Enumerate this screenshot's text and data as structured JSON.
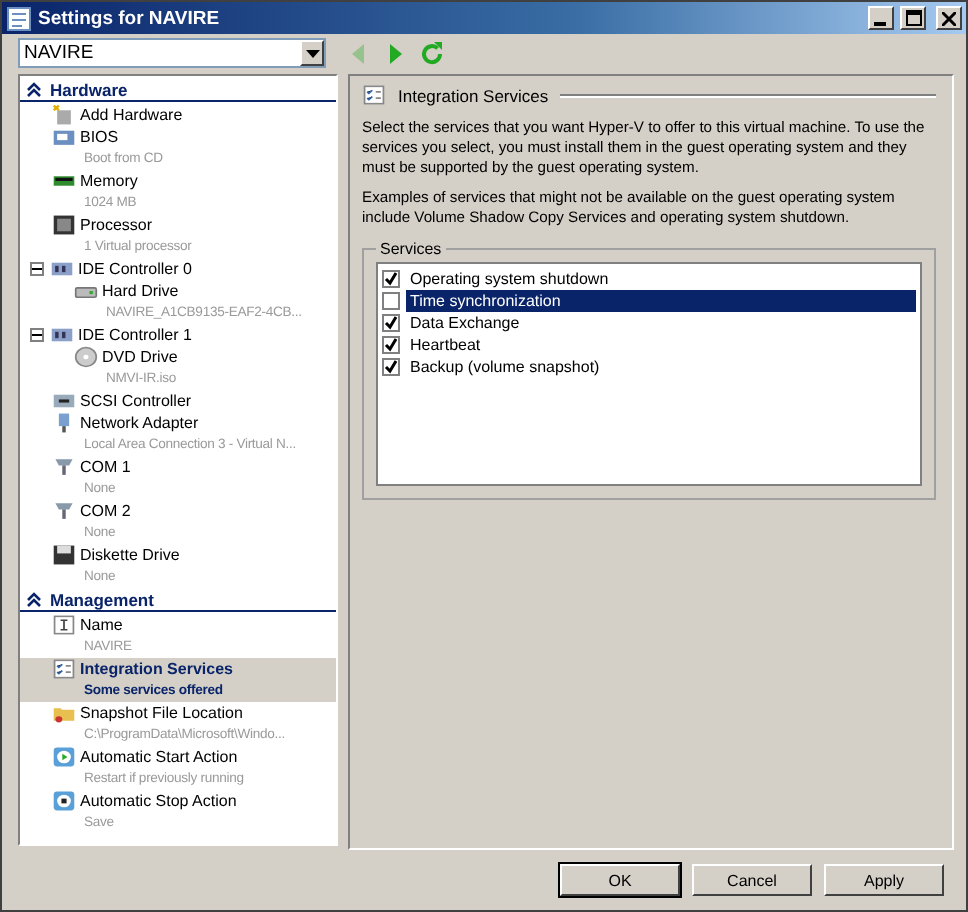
{
  "window": {
    "title": "Settings for NAVIRE"
  },
  "vm_select": {
    "value": "NAVIRE"
  },
  "nav": [
    {
      "kind": "back",
      "disabled": true
    },
    {
      "kind": "forward",
      "disabled": false
    },
    {
      "kind": "refresh",
      "disabled": false
    }
  ],
  "sidebar": {
    "sections": [
      {
        "title": "Hardware",
        "expanded": true,
        "items": [
          {
            "kind": "add",
            "name": "Add Hardware",
            "selected": false
          },
          {
            "kind": "bios",
            "name": "BIOS",
            "detail": "Boot from CD",
            "selected": false
          },
          {
            "kind": "memory",
            "name": "Memory",
            "detail": "1024 MB",
            "selected": false
          },
          {
            "kind": "processor",
            "name": "Processor",
            "detail": "1 Virtual processor",
            "selected": false
          },
          {
            "kind": "controller",
            "name": "IDE Controller 0",
            "selected": false,
            "expanded": true,
            "children": [
              {
                "kind": "disk",
                "name": "Hard Drive",
                "detail": "NAVIRE_A1CB9135-EAF2-4CB...",
                "selected": false
              }
            ]
          },
          {
            "kind": "controller",
            "name": "IDE Controller 1",
            "selected": false,
            "expanded": true,
            "children": [
              {
                "kind": "dvd",
                "name": "DVD Drive",
                "detail": "NMVI-IR.iso",
                "selected": false
              }
            ]
          },
          {
            "kind": "scsi",
            "name": "SCSI Controller",
            "selected": false
          },
          {
            "kind": "network",
            "name": "Network Adapter",
            "detail": "Local Area Connection 3 - Virtual N...",
            "selected": false
          },
          {
            "kind": "port",
            "name": "COM 1",
            "detail": "None",
            "selected": false
          },
          {
            "kind": "port",
            "name": "COM 2",
            "detail": "None",
            "selected": false
          },
          {
            "kind": "floppy",
            "name": "Diskette Drive",
            "detail": "None",
            "selected": false
          }
        ]
      },
      {
        "title": "Management",
        "expanded": true,
        "items": [
          {
            "kind": "name",
            "name": "Name",
            "detail": "NAVIRE",
            "selected": false
          },
          {
            "kind": "services",
            "name": "Integration Services",
            "detail": "Some services offered",
            "selected": true
          },
          {
            "kind": "folder",
            "name": "Snapshot File Location",
            "detail": "C:\\ProgramData\\Microsoft\\Windo...",
            "selected": false
          },
          {
            "kind": "start",
            "name": "Automatic Start Action",
            "detail": "Restart if previously running",
            "selected": false
          },
          {
            "kind": "stop",
            "name": "Automatic Stop Action",
            "detail": "Save",
            "selected": false
          }
        ]
      }
    ]
  },
  "panel": {
    "title": "Integration Services",
    "paragraphs": [
      "Select the services that you want Hyper-V to offer to this virtual machine. To use the services you select, you must install them in the guest operating system and they must be supported by the guest operating system.",
      "Examples of services that might not be available on the guest operating system include Volume Shadow Copy Services and operating system shutdown."
    ],
    "services": {
      "label": "Services",
      "items": [
        {
          "label": "Operating system shutdown",
          "checked": true,
          "selected": false
        },
        {
          "label": "Time synchronization",
          "checked": false,
          "selected": true
        },
        {
          "label": "Data Exchange",
          "checked": true,
          "selected": false
        },
        {
          "label": "Heartbeat",
          "checked": true,
          "selected": false
        },
        {
          "label": "Backup (volume snapshot)",
          "checked": true,
          "selected": false
        }
      ]
    }
  },
  "buttons": [
    "OK",
    "Cancel",
    "Apply"
  ]
}
